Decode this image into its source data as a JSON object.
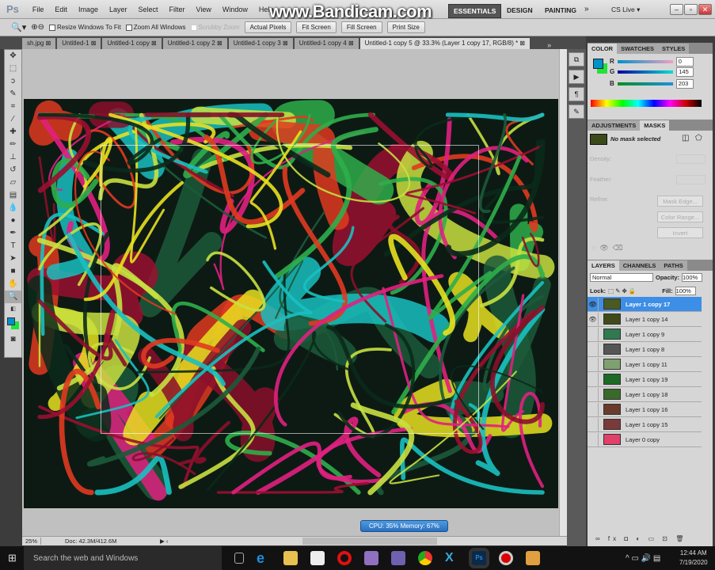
{
  "app": {
    "logo": "Ps",
    "watermark": "www.Bandicam.com"
  },
  "menu": [
    "File",
    "Edit",
    "Image",
    "Layer",
    "Select",
    "Filter",
    "View",
    "Window",
    "Help"
  ],
  "workspaces": {
    "essentials": "ESSENTIALS",
    "design": "DESIGN",
    "painting": "PAINTING",
    "more": "»",
    "cslive": "CS Live ▾"
  },
  "window_buttons": {
    "minimize": "–",
    "restore": "▫",
    "close": "✕"
  },
  "options": {
    "resize": "Resize Windows To Fit",
    "zoom_all": "Zoom All Windows",
    "scrubby": "Scrubby Zoom",
    "actual": "Actual Pixels",
    "fit": "Fit Screen",
    "fill": "Fill Screen",
    "print": "Print Size"
  },
  "tabs": [
    "sh.jpg ⊠",
    "Untitled-1 ⊠",
    "Untitled-1 copy ⊠",
    "Untitled-1 copy 2 ⊠",
    "Untitled-1 copy 3 ⊠",
    "Untitled-1 copy 4 ⊠",
    "Untitled-1 copy 5 @ 33.3% (Layer 1 copy 17, RGB/8) * ⊠"
  ],
  "tabs_more": "»",
  "status": {
    "zoom": "25%",
    "doc": "Doc: 42.3M/412.6M",
    "cpu": "CPU: 35%  Memory: 67%"
  },
  "color_panel": {
    "tabs": [
      "COLOR",
      "SWATCHES",
      "STYLES"
    ],
    "r_label": "R",
    "g_label": "G",
    "b_label": "B",
    "r": "0",
    "g": "145",
    "b": "203",
    "fg": "#0091cb",
    "bg": "#22e23a"
  },
  "masks_panel": {
    "tabs": [
      "ADJUSTMENTS",
      "MASKS"
    ],
    "no_mask": "No mask selected",
    "density": "Density:",
    "feather": "Feather:",
    "refine": "Refine:",
    "mask_edge": "Mask Edge...",
    "color_range": "Color Range...",
    "invert": "Invert"
  },
  "layers_panel": {
    "tabs": [
      "LAYERS",
      "CHANNELS",
      "PATHS"
    ],
    "blend": "Normal",
    "opacity_label": "Opacity:",
    "opacity": "100%",
    "lock_label": "Lock:",
    "fill_label": "Fill:",
    "fill": "100%",
    "layers": [
      {
        "name": "Layer 1 copy 17",
        "visible": true,
        "selected": true,
        "thumb": "#4a5a20"
      },
      {
        "name": "Layer 1 copy 14",
        "visible": true,
        "thumb": "#3f4a1a"
      },
      {
        "name": "Layer 1 copy 9",
        "thumb": "#2f7a50"
      },
      {
        "name": "Layer 1 copy 8",
        "thumb": "#555555"
      },
      {
        "name": "Layer 1 copy 11",
        "thumb": "#7fa070"
      },
      {
        "name": "Layer 1 copy 19",
        "thumb": "#1c6a24"
      },
      {
        "name": "Layer 1 copy 18",
        "thumb": "#3a6a2a"
      },
      {
        "name": "Layer 1 copy 16",
        "thumb": "#6a3a2a"
      },
      {
        "name": "Layer 1 copy 15",
        "thumb": "#7a3a3a"
      },
      {
        "name": "Layer 0 copy",
        "thumb": "#e0406a"
      }
    ]
  },
  "taskbar": {
    "search": "Search the web and Windows",
    "time": "12:44 AM",
    "date": "7/19/2020"
  }
}
